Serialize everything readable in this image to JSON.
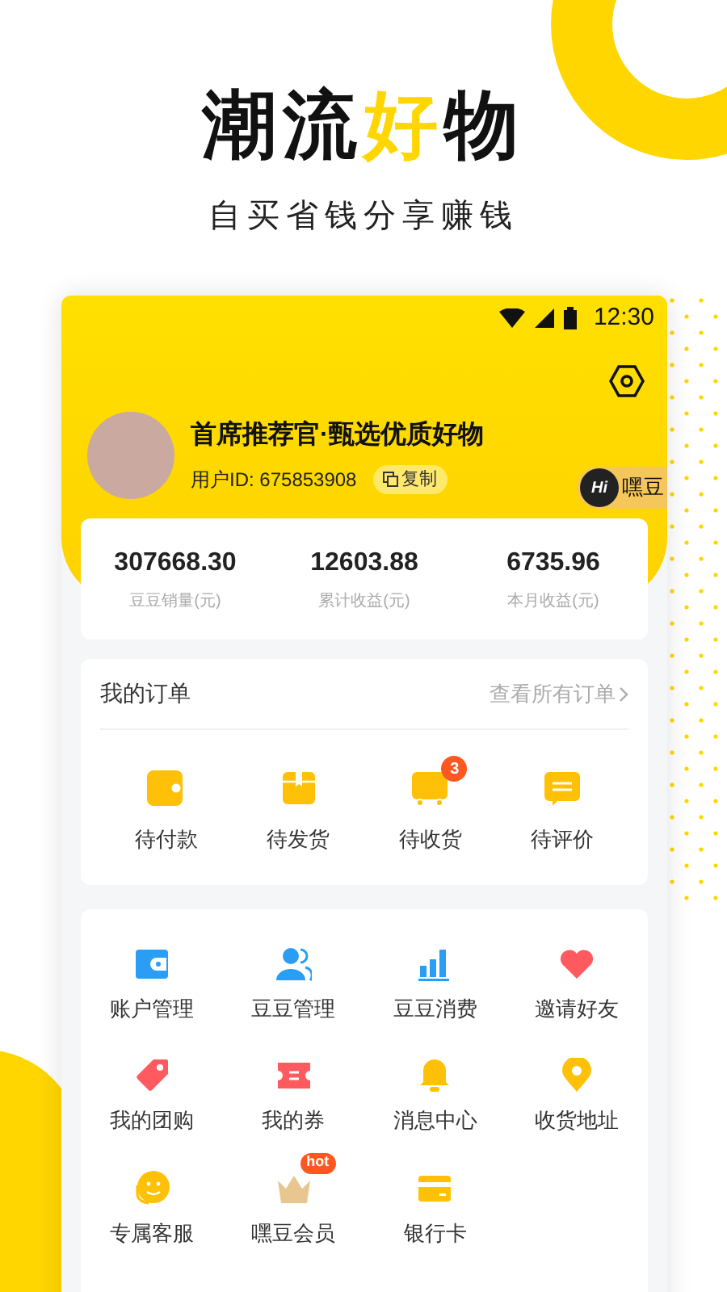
{
  "headline": {
    "parts": [
      {
        "text": "潮流",
        "highlight": false
      },
      {
        "text": "好",
        "highlight": true
      },
      {
        "text": "物",
        "highlight": false
      }
    ]
  },
  "tagline": "自买省钱分享赚钱",
  "status_bar": {
    "time": "12:30"
  },
  "profile": {
    "name": "首席推荐官·甄选优质好物",
    "user_id": "用户ID: 675853908",
    "copy_button": "复制",
    "brand_logo": "Hi",
    "brand_label": "嘿豆"
  },
  "stats": [
    {
      "value": "307668.30",
      "label": "豆豆销量(元)"
    },
    {
      "value": "12603.88",
      "label": "累计收益(元)"
    },
    {
      "value": "6735.96",
      "label": "本月收益(元)"
    }
  ],
  "orders": {
    "title": "我的订单",
    "view_all": "查看所有订单",
    "items": [
      {
        "label": "待付款"
      },
      {
        "label": "待发货"
      },
      {
        "label": "待收货",
        "badge": "3"
      },
      {
        "label": "待评价"
      }
    ]
  },
  "services": [
    {
      "label": "账户管理"
    },
    {
      "label": "豆豆管理"
    },
    {
      "label": "豆豆消费"
    },
    {
      "label": "邀请好友"
    },
    {
      "label": "我的团购"
    },
    {
      "label": "我的券"
    },
    {
      "label": "消息中心"
    },
    {
      "label": "收货地址"
    },
    {
      "label": "专属客服"
    },
    {
      "label": "嘿豆会员",
      "badge": "hot"
    },
    {
      "label": "银行卡"
    }
  ]
}
